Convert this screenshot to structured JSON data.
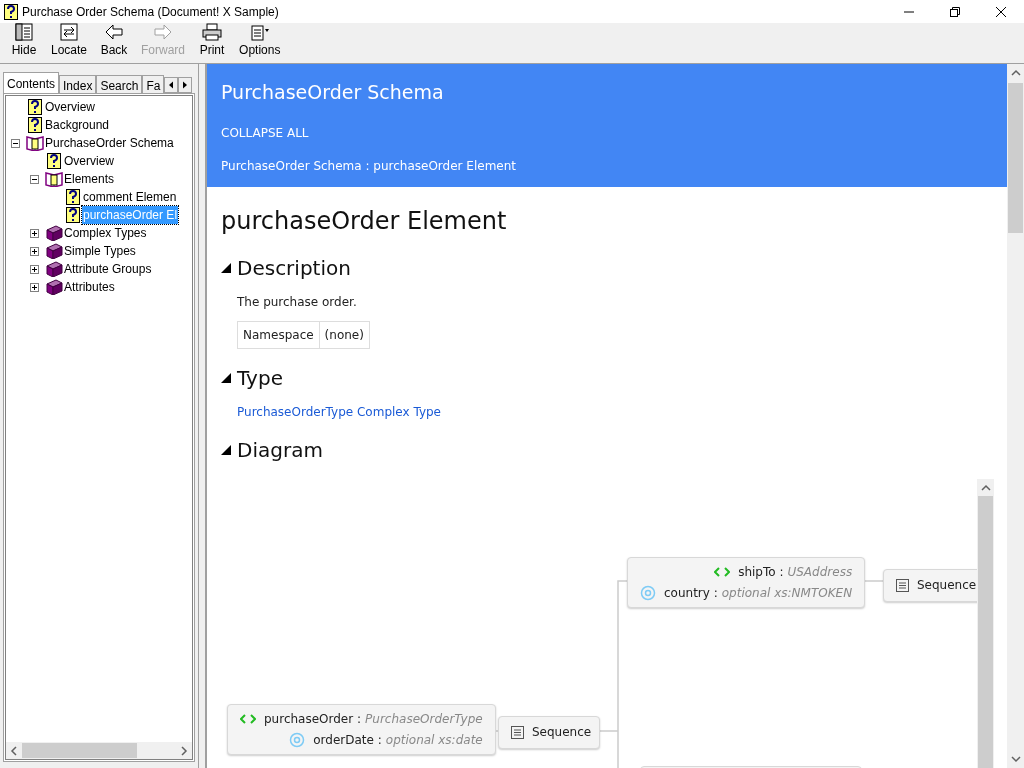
{
  "window": {
    "title": "Purchase Order Schema (Document! X Sample)"
  },
  "toolbar": [
    {
      "label": "Hide",
      "kind": "hide",
      "disabled": false
    },
    {
      "label": "Locate",
      "kind": "locate",
      "disabled": false
    },
    {
      "label": "Back",
      "kind": "back",
      "disabled": false
    },
    {
      "label": "Forward",
      "kind": "forward",
      "disabled": true
    },
    {
      "label": "Print",
      "kind": "print",
      "disabled": false
    },
    {
      "label": "Options",
      "kind": "options",
      "disabled": false
    }
  ],
  "tabs": [
    {
      "label": "Contents",
      "selected": true
    },
    {
      "label": "Index",
      "selected": false
    },
    {
      "label": "Search",
      "selected": false
    },
    {
      "label": "Fa",
      "selected": false
    }
  ],
  "tree": [
    {
      "label": "Overview",
      "kind": "page",
      "selected": false
    },
    {
      "label": "Background",
      "kind": "page",
      "selected": false
    },
    {
      "label": "PurchaseOrder Schema",
      "kind": "book",
      "expanded": true,
      "selected": false,
      "children": [
        {
          "label": "Overview",
          "kind": "page",
          "selected": false
        },
        {
          "label": "Elements",
          "kind": "book",
          "expanded": true,
          "selected": false,
          "children": [
            {
              "label": "comment Elemen",
              "kind": "page",
              "selected": false
            },
            {
              "label": "purchaseOrder El",
              "kind": "page",
              "selected": true
            }
          ]
        },
        {
          "label": "Complex Types",
          "kind": "book",
          "expanded": false,
          "selected": false
        },
        {
          "label": "Simple Types",
          "kind": "book",
          "expanded": false,
          "selected": false
        },
        {
          "label": "Attribute Groups",
          "kind": "book",
          "expanded": false,
          "selected": false
        },
        {
          "label": "Attributes",
          "kind": "book",
          "expanded": false,
          "selected": false
        }
      ]
    }
  ],
  "header": {
    "title": "PurchaseOrder Schema",
    "collapse": "COLLAPSE ALL",
    "breadcrumb": "PurchaseOrder Schema : purchaseOrder Element"
  },
  "page_title": "purchaseOrder Element",
  "sections": [
    {
      "heading": "Description",
      "text": "The purchase order.",
      "table": [
        [
          "Namespace",
          "(none)"
        ]
      ]
    },
    {
      "heading": "Type",
      "link": "PurchaseOrderType Complex Type"
    },
    {
      "heading": "Diagram"
    }
  ],
  "diagram": {
    "nodes": [
      {
        "kind": "element",
        "name": "purchaseOrder :",
        "type": "PurchaseOrderType",
        "attr": "orderDate :",
        "attr_type": "optional xs:date"
      },
      {
        "kind": "sequence",
        "label": "Sequence"
      },
      {
        "kind": "element",
        "name": "shipTo :",
        "type": "USAddress",
        "attr": "country :",
        "attr_type": "optional xs:NMTOKEN"
      },
      {
        "kind": "sequence",
        "label": "Sequence"
      }
    ]
  }
}
